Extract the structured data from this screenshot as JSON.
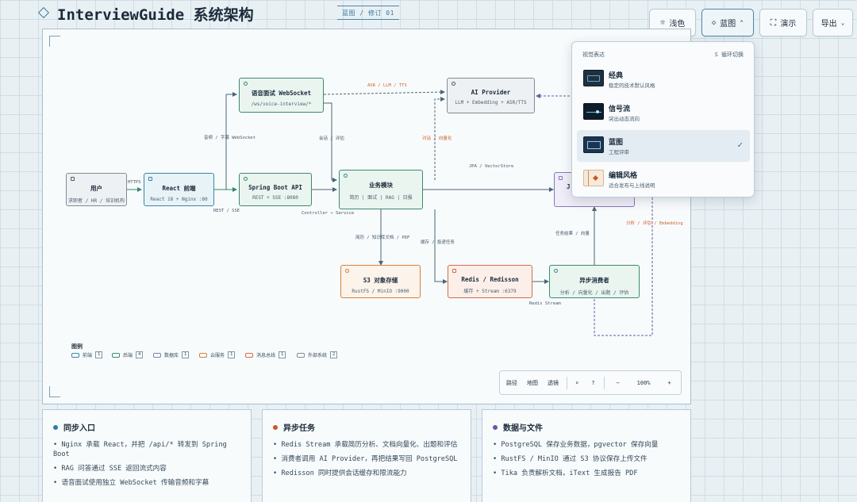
{
  "header": {
    "title": "InterviewGuide 系统架构",
    "revision": "蓝图 / 修订 01"
  },
  "toolbar": {
    "light_label": "浅色",
    "blueprint_label": "蓝图",
    "present_label": "演示",
    "export_label": "导出"
  },
  "dropdown": {
    "heading": "视觉表达",
    "cycle_hint": "S 循环切换",
    "items": [
      {
        "name": "经典",
        "desc": "稳定的技术默认风格"
      },
      {
        "name": "信号流",
        "desc": "突出动态流向"
      },
      {
        "name": "蓝图",
        "desc": "工程评审"
      },
      {
        "name": "编辑风格",
        "desc": "适合发布与上线说明"
      }
    ],
    "selected": "蓝图"
  },
  "diagram": {
    "nodes": {
      "user": {
        "title": "用户",
        "sub": "求职者 / HR / 培训机构"
      },
      "react": {
        "title": "React 前端",
        "sub": "React 18 + Nginx :80"
      },
      "spring": {
        "title": "Spring Boot API",
        "sub": "REST + SSE :8080"
      },
      "ws": {
        "title": "语音面试 WebSocket",
        "sub": "/ws/voice-interview/*"
      },
      "biz": {
        "title": "业务模块",
        "sub": "简历 | 面试 | RAG | 日报"
      },
      "ai": {
        "title": "AI Provider",
        "sub": "LLM + Embedding + ASR/TTS"
      },
      "s3": {
        "title": "S3 对象存储",
        "sub": "RustFS / MinIO :9000"
      },
      "redis": {
        "title": "Redis / Redisson",
        "sub": "缓存 + Stream :6379"
      },
      "async": {
        "title": "异步消费者",
        "sub": "分析 / 向量化 / 出题 / 评估"
      },
      "pg": {
        "title": "J"
      }
    },
    "edges": {
      "https": "HTTPS",
      "rest_sse": "REST / SSE",
      "audio_ws": "音频 / 字幕 WebSocket",
      "asr": "ASR / LLM / TTS",
      "session": "会话 / 评估",
      "dialog": "对话 / 向量化",
      "jpa": "JPA / VectorStore",
      "controller": "Controller → Service",
      "files": "简历 / 知识库文档 / PDF",
      "cache": "缓存 / 投递任务",
      "task_result": "任务结果 / 向量",
      "stream": "Redis Stream",
      "analysis": "分析 / 评估 / Embedding"
    },
    "legend": {
      "title": "图例",
      "items": [
        {
          "label": "前端",
          "count": "1",
          "color": "#3a86a6"
        },
        {
          "label": "后端",
          "count": "4",
          "color": "#3a8a70"
        },
        {
          "label": "数据库",
          "count": "1",
          "color": "#8878b5"
        },
        {
          "label": "云服务",
          "count": "1",
          "color": "#d6803a"
        },
        {
          "label": "消息总线",
          "count": "1",
          "color": "#cf6e48"
        },
        {
          "label": "外部系统",
          "count": "2",
          "color": "#7f8c96"
        }
      ]
    }
  },
  "zoom": {
    "path": "路径",
    "map": "地图",
    "lens": "透镜",
    "level": "100%",
    "minus": "−",
    "plus": "+"
  },
  "cards": [
    {
      "title": "同步入口",
      "color": "#2a7fa8",
      "items": [
        "Nginx 承载 React，并把 /api/* 转发到 Spring Boot",
        "RAG 问答通过 SSE 返回流式内容",
        "语音面试使用独立 WebSocket 传输音频和字幕"
      ]
    },
    {
      "title": "异步任务",
      "color": "#c9572b",
      "items": [
        "Redis Stream 承载简历分析、文档向量化、出题和评估",
        "消费者调用 AI Provider，再把结果写回 PostgreSQL",
        "Redisson 同时提供会话缓存和限流能力"
      ]
    },
    {
      "title": "数据与文件",
      "color": "#6a55a8",
      "items": [
        "PostgreSQL 保存业务数据，pgvector 保存向量",
        "RustFS / MinIO 通过 S3 协议保存上传文件",
        "Tika 负责解析文档，iText 生成报告 PDF"
      ]
    }
  ]
}
